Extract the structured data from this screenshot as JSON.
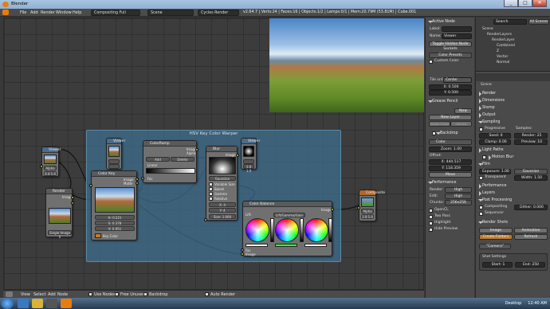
{
  "window": {
    "title": "Blender",
    "controls": [
      "_",
      "□",
      "✕"
    ]
  },
  "menubar": {
    "menus": [
      "File",
      "Add",
      "Render",
      "Window",
      "Help"
    ],
    "screen": "Compositing Full",
    "scene": "Scene",
    "engine": "Cycles Render",
    "stats": "v2.64.7 | Verts:24 | Faces:16 | Objects:1/2 | Lamps:0/1 | Mem:20.79M (53.81M) | Cube.001"
  },
  "frame": {
    "title": "HSV Key Color Warper"
  },
  "nodes": {
    "viewer_left": {
      "title": "Viewer",
      "alpha": "Alpha",
      "value": "0.4 1.0"
    },
    "render_layers": {
      "title": "Render",
      "out": "Image",
      "btn": "Single Image 0"
    },
    "viewer_top": {
      "title": "Viewer"
    },
    "color_key": {
      "title": "Color Key",
      "image_in": "Image",
      "matte_out": "Matte",
      "h": "H: 0.221",
      "s": "S: 0.378",
      "v": "V: 0.951",
      "key": "Key Color"
    },
    "color_ramp": {
      "title": "ColorRamp",
      "image": "Image",
      "alpha": "Alpha",
      "add": "Add",
      "delete": "Delete",
      "interp": "Linear",
      "fac": "Fac"
    },
    "blur": {
      "title": "Blur",
      "image": "Image",
      "type": "Gaussian",
      "opts": [
        "Variable Size",
        "Bokeh",
        "Gamma",
        "Relative"
      ],
      "x": "X: 4",
      "y": "Y: 4",
      "size": "Size: 1.000"
    },
    "viewer_mid": {
      "title": "Viewer",
      "value": "1.0 1.0"
    },
    "color_balance": {
      "title": "Color Balance",
      "image": "Image",
      "mode": "Lift/Gamma/Gain",
      "lift": "Lift:",
      "gamma": "Gamma:",
      "gain": "Gain:",
      "fac": "Fac",
      "image_in": "Image"
    },
    "composite": {
      "title": "Composite",
      "alpha": "Alpha",
      "value": "1.0 1.0"
    }
  },
  "node_toolbar": {
    "items": [
      "View",
      "Select",
      "Add",
      "Node"
    ],
    "checks": [
      "Use Nodes",
      "Free Unused",
      "Backdrop",
      "Auto Render"
    ]
  },
  "npanel": {
    "active_node": "Active Node",
    "label_lbl": "Label:",
    "name_lbl": "Name:",
    "name_val": "Viewer",
    "toggle_hidden": "Toggle Hidden Node Sockets",
    "color_presets": "Color Presets",
    "custom_color": "Custom Color",
    "tile_order_lbl": "Tile order:",
    "tile_order": "Center",
    "x": "X: 0.500",
    "y": "Y: 0.500",
    "grease_pencil": "Grease Pencil",
    "new": "New",
    "new_layer": "New Layer",
    "sketch": "Delete Frame",
    "convert": "Convert",
    "backdrop": "Backdrop",
    "color": "Color",
    "zoom": "Zoom: 1.00",
    "offset": "Offset:",
    "ox": "X: 444.517",
    "oy": "Y: 118.359",
    "move": "Move",
    "performance": "Performance",
    "render_lbl": "Render:",
    "render_val": "High",
    "edit_lbl": "Edit:",
    "edit_val": "High",
    "chunks_lbl": "Chunks:",
    "chunks_val": "256x256",
    "opencl": "OpenCL",
    "two_pass": "Two Pass",
    "highlight": "Highlight",
    "hide_preview": "Hide Preview"
  },
  "outliner": {
    "search": "Search",
    "scenes": "All Scenes",
    "items": [
      "Scene",
      "RenderLayers",
      "RenderLayer",
      "Combined",
      "Z",
      "Vector",
      "Normal"
    ]
  },
  "properties": {
    "scene": "Scene",
    "sections": [
      "Render",
      "Dimensions",
      "Stamp",
      "Output",
      "Sampling"
    ],
    "progressive": "Progressive",
    "samples": "Samples:",
    "seed": "Seed: 0",
    "render_s": "Render: 25",
    "clamp": "Clamp: 0.00",
    "preview_s": "Preview: 10",
    "light_paths": "Light Paths",
    "motion_blur": "Motion Blur",
    "film": "Film",
    "exposure": "Exposure: 1.00",
    "filter": "Gaussian",
    "transparent": "Transparent",
    "width": "Width: 1.50",
    "performance": "Performance",
    "layers": "Layers",
    "post": "Post Processing",
    "compositing": "Compositing",
    "dither": "Dither: 0.000",
    "sequencer": "Sequencer",
    "render_shots": "Render Shots",
    "image": "Image",
    "animation": "Animation",
    "create_folders": "Create Folders",
    "refresh": "Refresh",
    "camera": "\"Camera\"",
    "shot_settings": "Shot Settings",
    "start": "Start: 1",
    "end": "End: 250"
  },
  "taskbar": {
    "desktop": "Desktop",
    "time": "12:40 AM"
  }
}
